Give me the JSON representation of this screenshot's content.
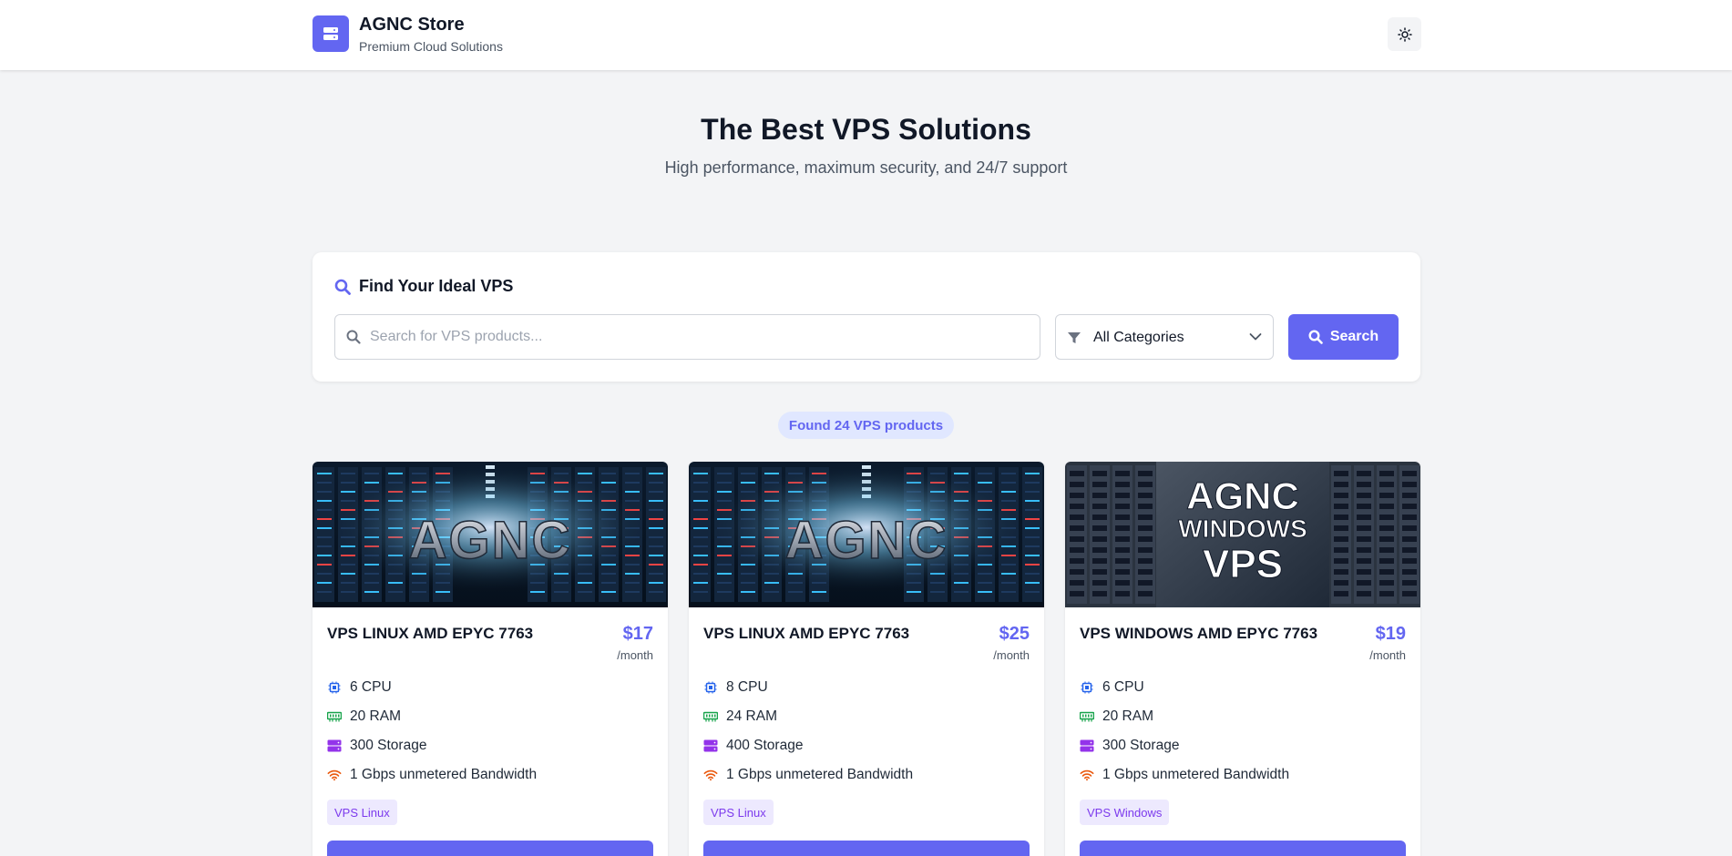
{
  "header": {
    "brand_title": "AGNC Store",
    "brand_subtitle": "Premium Cloud Solutions",
    "logo_icon": "server-icon",
    "theme_icon": "sun-icon"
  },
  "hero": {
    "title": "The Best VPS Solutions",
    "subtitle": "High performance, maximum security, and 24/7 support"
  },
  "search": {
    "heading": "Find Your Ideal VPS",
    "placeholder": "Search for VPS products...",
    "value": "",
    "category_selected": "All Categories",
    "button_label": "Search"
  },
  "results": {
    "found_label": "Found 24 VPS products"
  },
  "colors": {
    "accent": "#6366f1",
    "cpu": "#2563eb",
    "ram": "#16a34a",
    "storage": "#9333ea",
    "bandwidth": "#ea580c",
    "tag_bg": "#ede9fe",
    "tag_text": "#7c3aed"
  },
  "products": [
    {
      "image_text": "AGNC",
      "name": "VPS LINUX AMD EPYC 7763",
      "price": "$17",
      "period": "/month",
      "cpu": "6 CPU",
      "ram": "20 RAM",
      "storage": "300 Storage",
      "bandwidth": "1 Gbps unmetered Bandwidth",
      "tag": "VPS Linux"
    },
    {
      "image_text": "AGNC",
      "name": "VPS LINUX AMD EPYC 7763",
      "price": "$25",
      "period": "/month",
      "cpu": "8 CPU",
      "ram": "24 RAM",
      "storage": "400 Storage",
      "bandwidth": "1 Gbps unmetered Bandwidth",
      "tag": "VPS Linux"
    },
    {
      "image_text_lines": [
        "AGNC",
        "WINDOWS",
        "VPS"
      ],
      "name": "VPS WINDOWS AMD EPYC 7763",
      "price": "$19",
      "period": "/month",
      "cpu": "6 CPU",
      "ram": "20 RAM",
      "storage": "300 Storage",
      "bandwidth": "1 Gbps unmetered Bandwidth",
      "tag": "VPS Windows"
    }
  ]
}
